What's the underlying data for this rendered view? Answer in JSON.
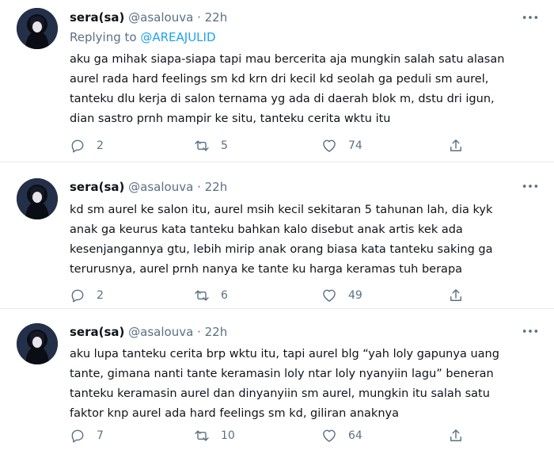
{
  "tweets": [
    {
      "name": "sera(sa)",
      "handle": "@asalouva",
      "dot": "·",
      "time": "22h",
      "replying_prefix": "Replying to",
      "replying_to": "@AREAJULID",
      "lines": [
        "aku ga mihak siapa-siapa tapi mau bercerita aja mungkin salah satu alasan",
        "aurel rada hard feelings sm kd krn dri kecil kd seolah ga peduli sm aurel,",
        "tanteku dlu kerja di salon ternama yg ada di daerah blok m, dstu dri igun,",
        "dian sastro prnh mampir ke situ, tanteku cerita wktu itu"
      ],
      "replies": "2",
      "retweets": "5",
      "likes": "74"
    },
    {
      "name": "sera(sa)",
      "handle": "@asalouva",
      "dot": "·",
      "time": "22h",
      "lines": [
        "kd sm aurel ke salon itu, aurel msih kecil sekitaran 5 tahunan lah, dia kyk",
        "anak ga keurus kata tanteku bahkan kalo disebut anak artis kek ada",
        "kesenjangannya gtu, lebih mirip anak orang biasa kata tanteku saking ga",
        "terurusnya, aurel prnh nanya ke tante ku harga keramas tuh berapa"
      ],
      "replies": "2",
      "retweets": "6",
      "likes": "49"
    },
    {
      "name": "sera(sa)",
      "handle": "@asalouva",
      "dot": "·",
      "time": "22h",
      "lines": [
        "aku lupa tanteku cerita brp wktu itu, tapi aurel blg “yah loly gapunya uang",
        "tante, gimana nanti tante keramasin loly ntar loly nyanyiin lagu” beneran",
        "tanteku keramasin aurel dan dinyanyiin sm aurel, mungkin itu salah satu",
        "faktor knp aurel ada hard feelings sm kd, giliran anaknya"
      ],
      "replies": "7",
      "retweets": "10",
      "likes": "64"
    }
  ],
  "icons": {
    "more": "more-horizontal-icon",
    "reply": "speech-bubble-icon",
    "retweet": "retweet-arrows-icon",
    "like": "heart-icon",
    "share": "share-arrow-icon"
  },
  "colors": {
    "text": "#0f1419",
    "secondary": "#5b7083",
    "link": "#1da1f2",
    "divider": "#e6ecf0"
  }
}
